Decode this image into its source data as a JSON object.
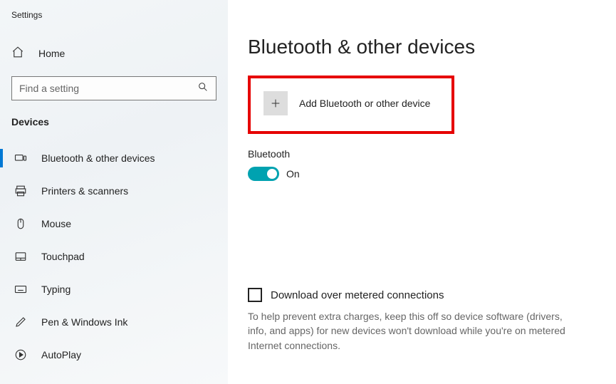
{
  "app": {
    "title": "Settings"
  },
  "sidebar": {
    "home_label": "Home",
    "search_placeholder": "Find a setting",
    "category_label": "Devices",
    "items": [
      {
        "label": "Bluetooth & other devices"
      },
      {
        "label": "Printers & scanners"
      },
      {
        "label": "Mouse"
      },
      {
        "label": "Touchpad"
      },
      {
        "label": "Typing"
      },
      {
        "label": "Pen & Windows Ink"
      },
      {
        "label": "AutoPlay"
      }
    ]
  },
  "main": {
    "page_title": "Bluetooth & other devices",
    "add_device_label": "Add Bluetooth or other device",
    "bluetooth_section_label": "Bluetooth",
    "bluetooth_toggle_state": "On",
    "metered_checkbox_label": "Download over metered connections",
    "metered_help": "To help prevent extra charges, keep this off so device software (drivers, info, and apps) for new devices won't download while you're on metered Internet connections."
  }
}
